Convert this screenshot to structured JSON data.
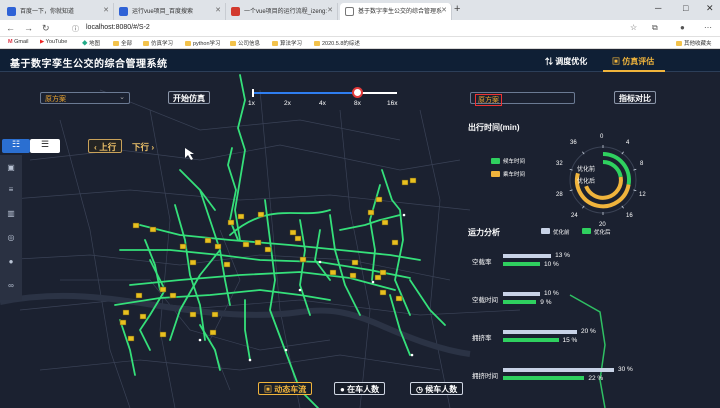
{
  "browser": {
    "tabs": [
      {
        "label": "百度一下，你就知道",
        "active": false
      },
      {
        "label": "运行vue项目_百度搜索",
        "active": false
      },
      {
        "label": "一个vue项目的运行流程_izeng:",
        "active": false
      },
      {
        "label": "基于数字孪生公交的综合管理系",
        "active": true
      }
    ],
    "url": "localhost:8080/#/S-2",
    "bookmarks": [
      "Gmail",
      "YouTube",
      "地图",
      "全部",
      "仿真学习",
      "python学习",
      "公司信息",
      "算法学习",
      "2020.5.8的综述",
      "其他收藏夹"
    ]
  },
  "app": {
    "title": "基于数字孪生公交的综合管理系统",
    "menu": [
      {
        "label": "调度优化",
        "active": false
      },
      {
        "label": "仿真评估",
        "active": true
      }
    ],
    "scheme_select": "原方案",
    "start_button": "开始仿真",
    "speed": {
      "options": [
        "1x",
        "2x",
        "4x",
        "8x",
        "16x"
      ],
      "selected": "8x"
    },
    "direction": {
      "up": "上行",
      "down": "下行"
    },
    "right_select": "原方案",
    "compare_button": "指标对比",
    "travel_time": {
      "title": "出行时间(min)",
      "legend": [
        "候车时间",
        "乘车时间"
      ],
      "ticks": [
        "0",
        "4",
        "8",
        "12",
        "16",
        "20",
        "24",
        "28",
        "32",
        "36"
      ],
      "labels": {
        "outer": "优化前",
        "inner": "优化后"
      }
    },
    "capacity": {
      "title": "运力分析",
      "legend": [
        "优化前",
        "优化后"
      ],
      "rows": [
        {
          "label": "空载率",
          "before_text": "13 %",
          "after_text": "10 %",
          "before": 13,
          "after": 10
        },
        {
          "label": "空载时间",
          "before_text": "10 %",
          "after_text": "9 %",
          "before": 10,
          "after": 9
        },
        {
          "label": "拥挤率",
          "before_text": "20 %",
          "after_text": "15 %",
          "before": 20,
          "after": 15
        },
        {
          "label": "拥挤时间",
          "before_text": "30 %",
          "after_text": "22 %",
          "before": 30,
          "after": 22
        }
      ]
    },
    "bottom_tabs": [
      {
        "label": "动态车流",
        "active": true
      },
      {
        "label": "在车人数",
        "active": false
      },
      {
        "label": "候车人数",
        "active": false
      }
    ],
    "colors": {
      "route": "#35e07a",
      "accent": "#f0b43c",
      "before_bar": "#c8d2e6",
      "after_bar": "#2fd05f",
      "bus": "#e8c020"
    }
  }
}
